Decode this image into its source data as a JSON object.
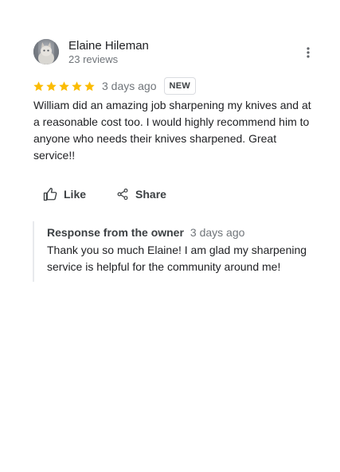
{
  "reviewer": {
    "name": "Elaine Hileman",
    "review_count": "23 reviews"
  },
  "review": {
    "rating": 5,
    "max_rating": 5,
    "star_color": "#fbbc04",
    "date": "3 days ago",
    "badge": "NEW",
    "text": "William did an amazing job sharpening my knives and at a reasonable cost too. I would highly recommend him to anyone who needs their knives sharpened. Great service!!"
  },
  "actions": {
    "like_label": "Like",
    "share_label": "Share",
    "like_icon": "thumb-up-icon",
    "share_icon": "share-icon",
    "more_icon": "more-vert-icon"
  },
  "owner_response": {
    "title": "Response from the owner",
    "date": "3 days ago",
    "text": "Thank you so much Elaine! I am glad my sharpening service is helpful for the community around me!"
  }
}
